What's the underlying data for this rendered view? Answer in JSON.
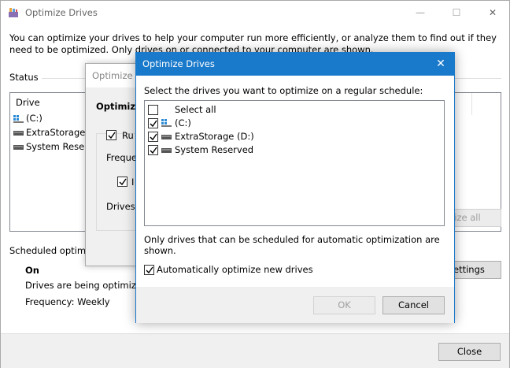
{
  "main": {
    "title": "Optimize Drives",
    "controls": {
      "minimize": "—",
      "maximize": "☐",
      "close": "✕"
    },
    "intro": "You can optimize your drives to help your computer run more efficiently, or analyze them to find out if they need to be optimized. Only drives on or connected to your computer are shown.",
    "status_label": "Status",
    "drive_header": "Drive",
    "drives": [
      "(C:)",
      "ExtraStorage (D:",
      "System Reserve"
    ],
    "optimize_all_fragment": "nize all",
    "scheduled_label": "Scheduled optimiza",
    "schedule_status": "On",
    "schedule_desc": "Drives are being optimized a",
    "frequency": "Frequency: Weekly",
    "change_settings_fragment": "ettings",
    "close_button": "Close"
  },
  "middle": {
    "title": "Optimize D",
    "heading": "Optimizat",
    "run_label": "Ru",
    "frequency_label": "Frequer",
    "notify_label": "I",
    "drives_label": "Drives"
  },
  "dialog": {
    "title": "Optimize Drives",
    "close": "✕",
    "prompt": "Select the drives you want to optimize on a regular schedule:",
    "select_all": "Select all",
    "drives": [
      {
        "label": "(C:)",
        "icon": "windows-drive-icon",
        "checked": true
      },
      {
        "label": "ExtraStorage (D:)",
        "icon": "hard-drive-icon",
        "checked": true
      },
      {
        "label": "System Reserved",
        "icon": "hard-drive-icon",
        "checked": true
      }
    ],
    "info": "Only drives that can be scheduled for automatic optimization are shown.",
    "auto_optimize": "Automatically optimize new drives",
    "ok": "OK",
    "cancel": "Cancel"
  },
  "colors": {
    "accent": "#1979ca",
    "button_bg": "#e1e1e1",
    "footer_bg": "#f0f0f0"
  }
}
